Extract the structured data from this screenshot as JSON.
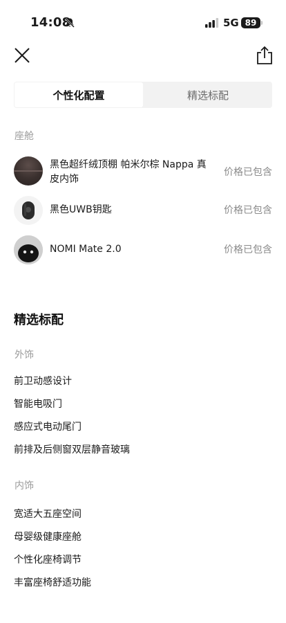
{
  "status_bar": {
    "time": "14:08",
    "network": "5G",
    "battery": "89"
  },
  "tabs": [
    {
      "label": "个性化配置",
      "active": true
    },
    {
      "label": "精选标配",
      "active": false
    }
  ],
  "cabin": {
    "title": "座舱",
    "items": [
      {
        "name": "黑色超纤绒顶棚 帕米尔棕 Nappa 真皮内饰",
        "price": "价格已包含",
        "thumb": "headliner-swatch"
      },
      {
        "name": "黑色UWB钥匙",
        "price": "价格已包含",
        "thumb": "key-fob"
      },
      {
        "name": "NOMI Mate 2.0",
        "price": "价格已包含",
        "thumb": "nomi-robot"
      }
    ]
  },
  "standard": {
    "heading": "精选标配",
    "exterior": {
      "title": "外饰",
      "items": [
        "前卫动感设计",
        "智能电吸门",
        "感应式电动尾门",
        "前排及后侧窗双层静音玻璃"
      ]
    },
    "interior": {
      "title": "内饰",
      "items": [
        "宽适大五座空间",
        "母婴级健康座舱",
        "个性化座椅调节",
        "丰富座椅舒适功能"
      ]
    }
  },
  "icons": [
    "bell-slash-icon",
    "signal-icon",
    "close-icon",
    "share-icon"
  ]
}
